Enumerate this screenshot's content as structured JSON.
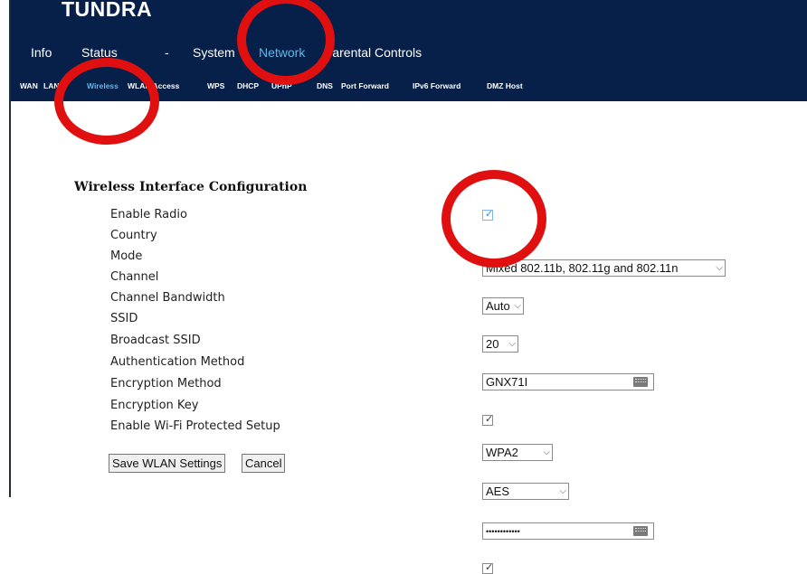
{
  "brand": "TUNDRA",
  "top_nav": [
    {
      "label": "Info"
    },
    {
      "label": "Status"
    },
    {
      "label": "-"
    },
    {
      "label": "System"
    },
    {
      "label": "Network"
    },
    {
      "label": "Parental Controls"
    }
  ],
  "sub_nav": [
    {
      "label": "WAN"
    },
    {
      "label": "LAN"
    },
    {
      "label": "Wireless"
    },
    {
      "label": "WLAN Access"
    },
    {
      "label": "WPS"
    },
    {
      "label": "DHCP"
    },
    {
      "label": "UPnP"
    },
    {
      "label": "DNS"
    },
    {
      "label": "Port Forward"
    },
    {
      "label": "IPv6 Forward"
    },
    {
      "label": "DMZ Host"
    }
  ],
  "section_title": "Wireless Interface Configuration",
  "fields": {
    "enable_radio": {
      "label": "Enable Radio",
      "checked": true
    },
    "country": {
      "label": "Country"
    },
    "mode": {
      "label": "Mode",
      "value": "Mixed 802.11b, 802.11g and 802.11n"
    },
    "channel": {
      "label": "Channel",
      "value": "Auto"
    },
    "bandwidth": {
      "label": "Channel Bandwidth",
      "value": "20"
    },
    "ssid": {
      "label": "SSID",
      "value": "GNX71I"
    },
    "broadcast_ssid": {
      "label": "Broadcast SSID",
      "checked": true
    },
    "auth_method": {
      "label": "Authentication Method",
      "value": "WPA2"
    },
    "encryption_method": {
      "label": "Encryption Method",
      "value": "AES"
    },
    "encryption_key": {
      "label": "Encryption Key",
      "value": "••••••••••••"
    },
    "wps": {
      "label": "Enable Wi-Fi Protected Setup",
      "checked": true
    }
  },
  "buttons": {
    "save": "Save WLAN Settings",
    "cancel": "Cancel"
  },
  "icons": {
    "checkmark": "✓",
    "dropdown": "⌵"
  },
  "colors": {
    "header_bg": "#07204a",
    "active_nav": "#5fb8ea",
    "annotation_red": "#e01010"
  }
}
